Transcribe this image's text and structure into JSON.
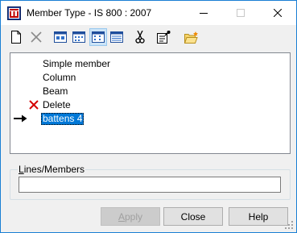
{
  "window": {
    "title": "Member Type - IS 800 : 2007"
  },
  "titlebar_buttons": {
    "minimize_glyph": "—",
    "maximize_glyph": "☐",
    "close_glyph": "✕"
  },
  "toolbar": {
    "icons": [
      "new-icon",
      "delete-icon",
      "large-icons-view-icon",
      "small-icons-view-icon",
      "list-view-icon",
      "details-view-icon",
      "cut-icon",
      "properties-icon",
      "open-folder-icon"
    ],
    "pressed": "list-view-icon"
  },
  "members": {
    "items": [
      {
        "label": "Simple member",
        "marker": ""
      },
      {
        "label": "Column",
        "marker": ""
      },
      {
        "label": "Beam",
        "marker": ""
      },
      {
        "label": "Delete",
        "marker": "red-x-icon"
      },
      {
        "label": "battens 4",
        "marker": "arrow-right-icon",
        "selected": true
      }
    ]
  },
  "lines_members": {
    "label_underlined": "L",
    "label_rest": "ines/Members",
    "value": ""
  },
  "buttons": {
    "apply_underlined": "A",
    "apply_rest": "pply",
    "apply_enabled": false,
    "close": "Close",
    "help": "Help"
  },
  "colors": {
    "accent": "#0078d7",
    "delete_mark": "#d40000"
  }
}
